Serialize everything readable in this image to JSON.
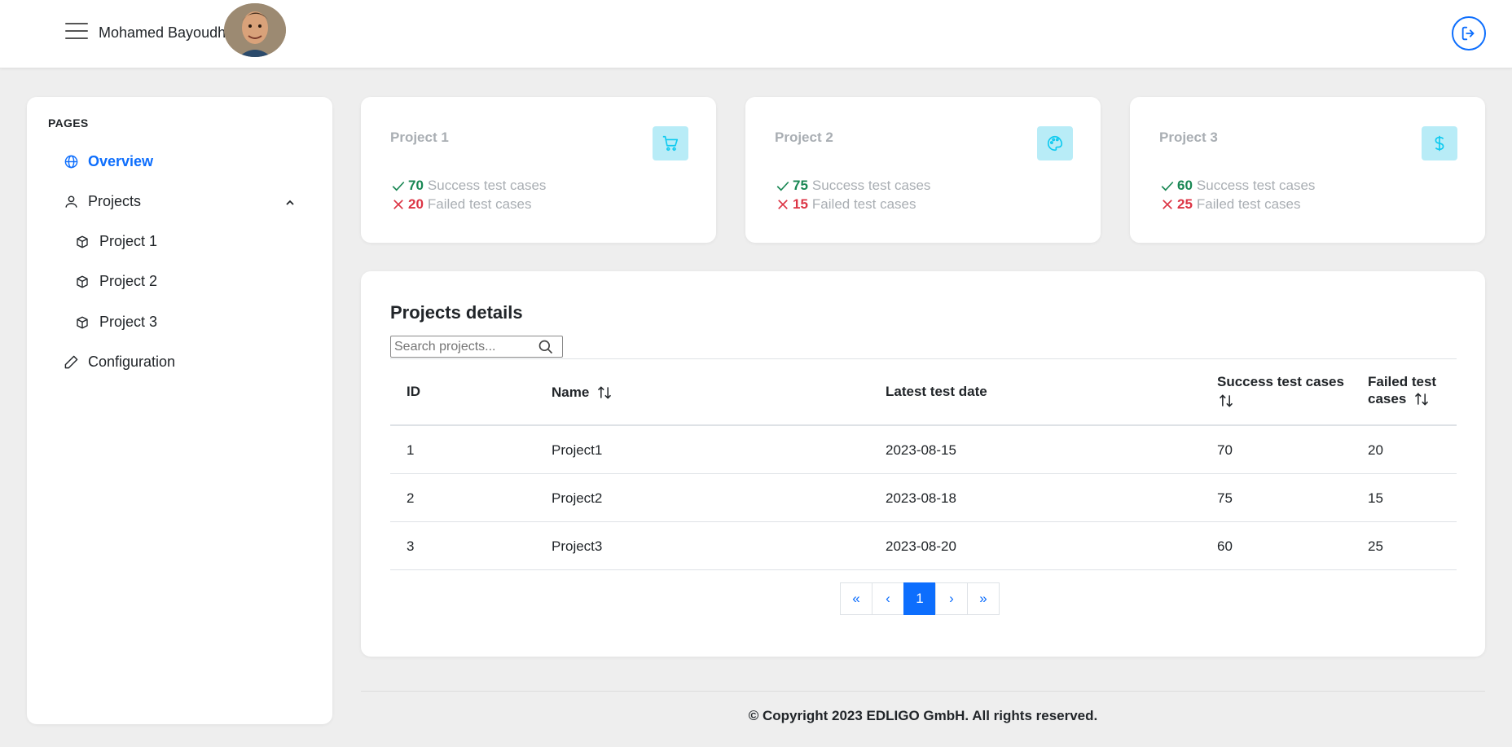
{
  "header": {
    "username": "Mohamed Bayoudhi"
  },
  "sidebar": {
    "heading": "PAGES",
    "items": [
      {
        "label": "Overview",
        "icon": "globe-icon"
      },
      {
        "label": "Projects",
        "icon": "person-icon"
      },
      {
        "label": "Project 1",
        "icon": "box-icon"
      },
      {
        "label": "Project 2",
        "icon": "box-icon"
      },
      {
        "label": "Project 3",
        "icon": "box-icon"
      },
      {
        "label": "Configuration",
        "icon": "pencil-icon"
      }
    ]
  },
  "cards": [
    {
      "title": "Project 1",
      "icon": "cart-icon",
      "success": "70",
      "success_label": "Success test cases",
      "failed": "20",
      "failed_label": "Failed test cases"
    },
    {
      "title": "Project 2",
      "icon": "palette-icon",
      "success": "75",
      "success_label": "Success test cases",
      "failed": "15",
      "failed_label": "Failed test cases"
    },
    {
      "title": "Project 3",
      "icon": "dollar-icon",
      "success": "60",
      "success_label": "Success test cases",
      "failed": "25",
      "failed_label": "Failed test cases"
    }
  ],
  "details": {
    "title": "Projects details",
    "search_placeholder": "Search projects...",
    "columns": {
      "id": "ID",
      "name": "Name",
      "date": "Latest test date",
      "success_l1": "Success test cases",
      "failed_l1": "Failed test",
      "failed_l2": "cases"
    },
    "rows": [
      {
        "id": "1",
        "name": "Project1",
        "date": "2023-08-15",
        "success": "70",
        "failed": "20"
      },
      {
        "id": "2",
        "name": "Project2",
        "date": "2023-08-18",
        "success": "75",
        "failed": "15"
      },
      {
        "id": "3",
        "name": "Project3",
        "date": "2023-08-20",
        "success": "60",
        "failed": "25"
      }
    ],
    "pagination": {
      "first": "«",
      "prev": "‹",
      "current": "1",
      "next": "›",
      "last": "»"
    }
  },
  "footer": {
    "text": "© Copyright 2023 EDLIGO GmbH. All rights reserved."
  },
  "colors": {
    "accent": "#0d6efd",
    "success": "#198754",
    "danger": "#dc3545",
    "icon_bg": "#b8ecf7"
  }
}
